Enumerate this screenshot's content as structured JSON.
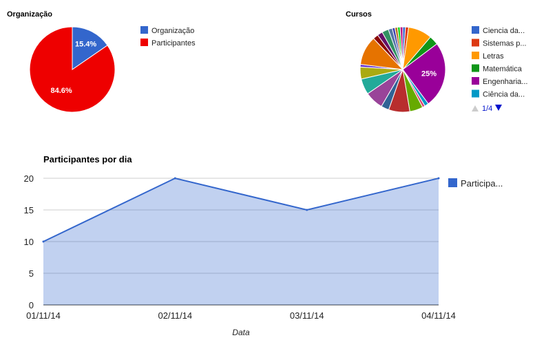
{
  "charts": {
    "organizacao": {
      "title": "Organização"
    },
    "cursos": {
      "title": "Cursos",
      "pager_label": "1/4",
      "pager_prev_icon": "triangle-up-icon",
      "pager_next_icon": "triangle-down-icon"
    },
    "participantes": {
      "title": "Participantes por dia",
      "xlabel": "Data"
    }
  },
  "chart_data": [
    {
      "type": "pie",
      "title": "Organização",
      "labels": [
        "Organização",
        "Participantes"
      ],
      "values": [
        15.4,
        84.6
      ],
      "slice_labels": [
        "15.4%",
        "84.6%"
      ],
      "colors": [
        "#3366cc",
        "#ee0000"
      ],
      "legend": "right"
    },
    {
      "type": "pie",
      "title": "Cursos",
      "legend": "right",
      "legend_entries": [
        {
          "label": "Ciencia da...",
          "color": "#3366cc"
        },
        {
          "label": "Sistemas p...",
          "color": "#dc3912"
        },
        {
          "label": "Letras",
          "color": "#ff9900"
        },
        {
          "label": "Matemática",
          "color": "#109618"
        },
        {
          "label": "Engenharia...",
          "color": "#990099"
        },
        {
          "label": "Ciência da...",
          "color": "#0099c6"
        }
      ],
      "slices": [
        {
          "value": 1.0,
          "color": "#3366cc"
        },
        {
          "value": 1.2,
          "color": "#dc3912"
        },
        {
          "value": 9.0,
          "color": "#ff9900"
        },
        {
          "value": 3.5,
          "color": "#109618"
        },
        {
          "value": 25.0,
          "color": "#990099",
          "label": "25%"
        },
        {
          "value": 1.5,
          "color": "#0099c6"
        },
        {
          "value": 1.0,
          "color": "#dd4477"
        },
        {
          "value": 5.0,
          "color": "#66aa00"
        },
        {
          "value": 8.0,
          "color": "#b82e2e"
        },
        {
          "value": 3.0,
          "color": "#316395"
        },
        {
          "value": 7.0,
          "color": "#994499"
        },
        {
          "value": 6.0,
          "color": "#22aa99"
        },
        {
          "value": 4.5,
          "color": "#aaaa11"
        },
        {
          "value": 1.0,
          "color": "#6633cc"
        },
        {
          "value": 11.0,
          "color": "#e67300"
        },
        {
          "value": 2.0,
          "color": "#8b0707"
        },
        {
          "value": 2.0,
          "color": "#651067"
        },
        {
          "value": 2.5,
          "color": "#329262"
        },
        {
          "value": 1.5,
          "color": "#5574a6"
        },
        {
          "value": 1.0,
          "color": "#3b3eac"
        },
        {
          "value": 1.0,
          "color": "#b77322"
        },
        {
          "value": 1.0,
          "color": "#16d620"
        },
        {
          "value": 1.0,
          "color": "#b91383"
        }
      ]
    },
    {
      "type": "area",
      "title": "Participantes por dia",
      "xlabel": "Data",
      "ylabel": "",
      "categories": [
        "01/11/14",
        "02/11/14",
        "03/11/14",
        "04/11/14"
      ],
      "series": [
        {
          "name": "Participa...",
          "values": [
            10,
            20,
            15,
            20
          ],
          "color": "#3366cc"
        }
      ],
      "ylim": [
        0,
        20
      ],
      "yticks": [
        0,
        5,
        10,
        15,
        20
      ],
      "grid": true,
      "legend": "right"
    }
  ]
}
